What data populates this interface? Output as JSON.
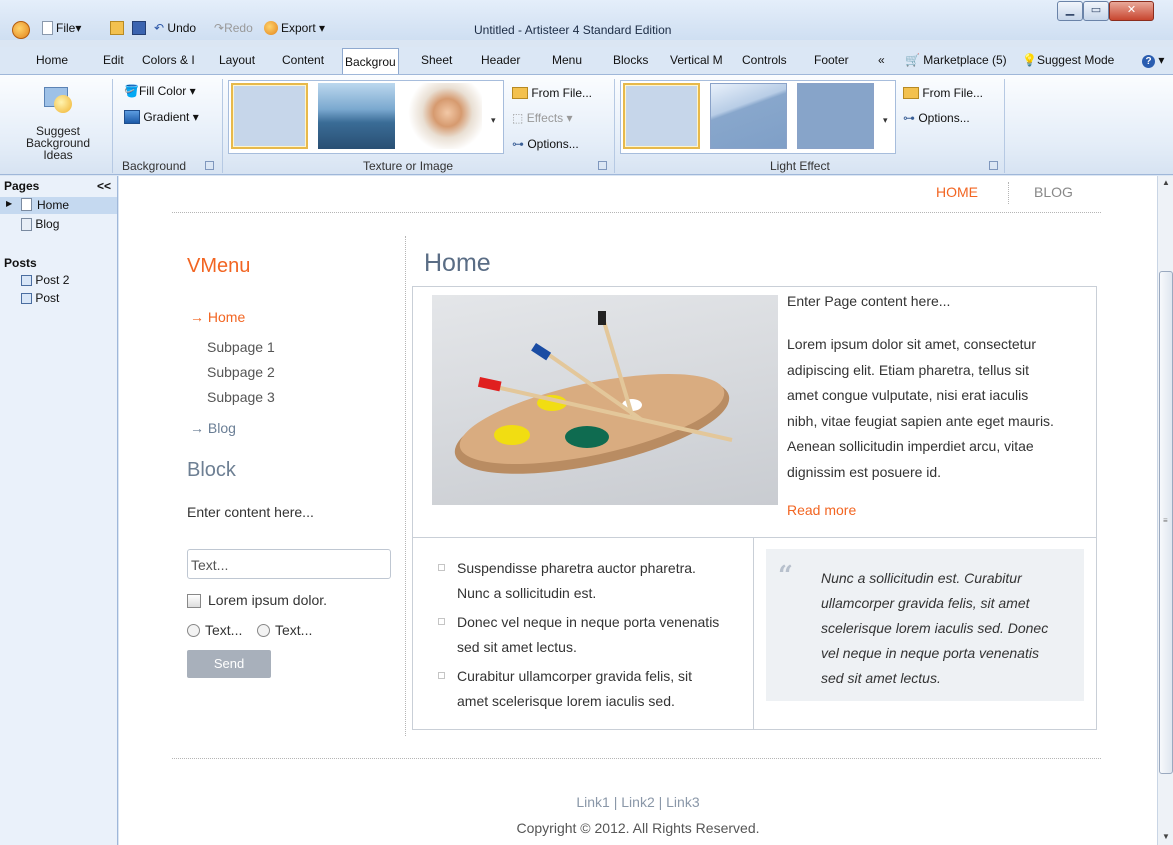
{
  "window": {
    "title": "Untitled - Artisteer 4 Standard Edition",
    "qat": {
      "file": "File",
      "undo": "Undo",
      "redo": "Redo",
      "export": "Export"
    },
    "tabs": [
      "Home",
      "Edit",
      "Colors & I",
      "Layout",
      "Content",
      "Backgrou",
      "Sheet",
      "Header",
      "Menu",
      "Blocks",
      "Vertical M",
      "Controls",
      "Footer",
      "«"
    ],
    "active_tab": "Backgrou",
    "marketplace": "Marketplace (5)",
    "suggest_mode": "Suggest Mode"
  },
  "ribbon": {
    "suggest": {
      "line1": "Suggest",
      "line2": "Background",
      "line3": "Ideas"
    },
    "fill_color": "Fill Color",
    "gradient": "Gradient",
    "group_background": "Background",
    "group_texture": "Texture or Image",
    "group_light": "Light Effect",
    "from_file": "From File...",
    "effects": "Effects",
    "options": "Options..."
  },
  "left_panel": {
    "pages_header": "Pages",
    "collapse": "<<",
    "pages": [
      "Home",
      "Blog"
    ],
    "posts_header": "Posts",
    "posts": [
      "Post 2",
      "Post"
    ]
  },
  "site": {
    "menu": {
      "home": "HOME",
      "blog": "BLOG"
    },
    "vmenu_title": "VMenu",
    "vmenu": {
      "home": "Home",
      "sub1": "Subpage 1",
      "sub2": "Subpage 2",
      "sub3": "Subpage 3",
      "blog": "Blog"
    },
    "block_title": "Block",
    "block_text": "Enter content here...",
    "text_input": "Text...",
    "checkbox_label": "Lorem ipsum dolor.",
    "radio1": "Text...",
    "radio2": "Text...",
    "send": "Send",
    "page_title": "Home",
    "intro": "Enter Page content here...",
    "lorem": [
      "Lorem ipsum dolor sit amet, consectetur",
      "adipiscing elit. Etiam pharetra, tellus sit",
      "amet congue vulputate, nisi erat iaculis",
      "nibh, vitae feugiat sapien ante eget mauris.",
      "Aenean sollicitudin imperdiet arcu, vitae",
      "dignissim est posuere id."
    ],
    "read_more": "Read more",
    "bullets": [
      [
        "Suspendisse pharetra auctor pharetra.",
        "Nunc a sollicitudin est."
      ],
      [
        "Donec vel neque in neque porta venenatis",
        "sed sit amet lectus."
      ],
      [
        "Curabitur ullamcorper gravida felis, sit",
        "amet scelerisque lorem iaculis sed."
      ]
    ],
    "quote": [
      "Nunc a sollicitudin est. Curabitur",
      "ullamcorper gravida felis, sit amet",
      "scelerisque lorem iaculis sed. Donec",
      "vel neque in neque porta venenatis",
      "sed sit amet lectus."
    ],
    "footer_links": "Link1 | Link2 | Link3",
    "copyright": "Copyright © 2012. All Rights Reserved."
  }
}
